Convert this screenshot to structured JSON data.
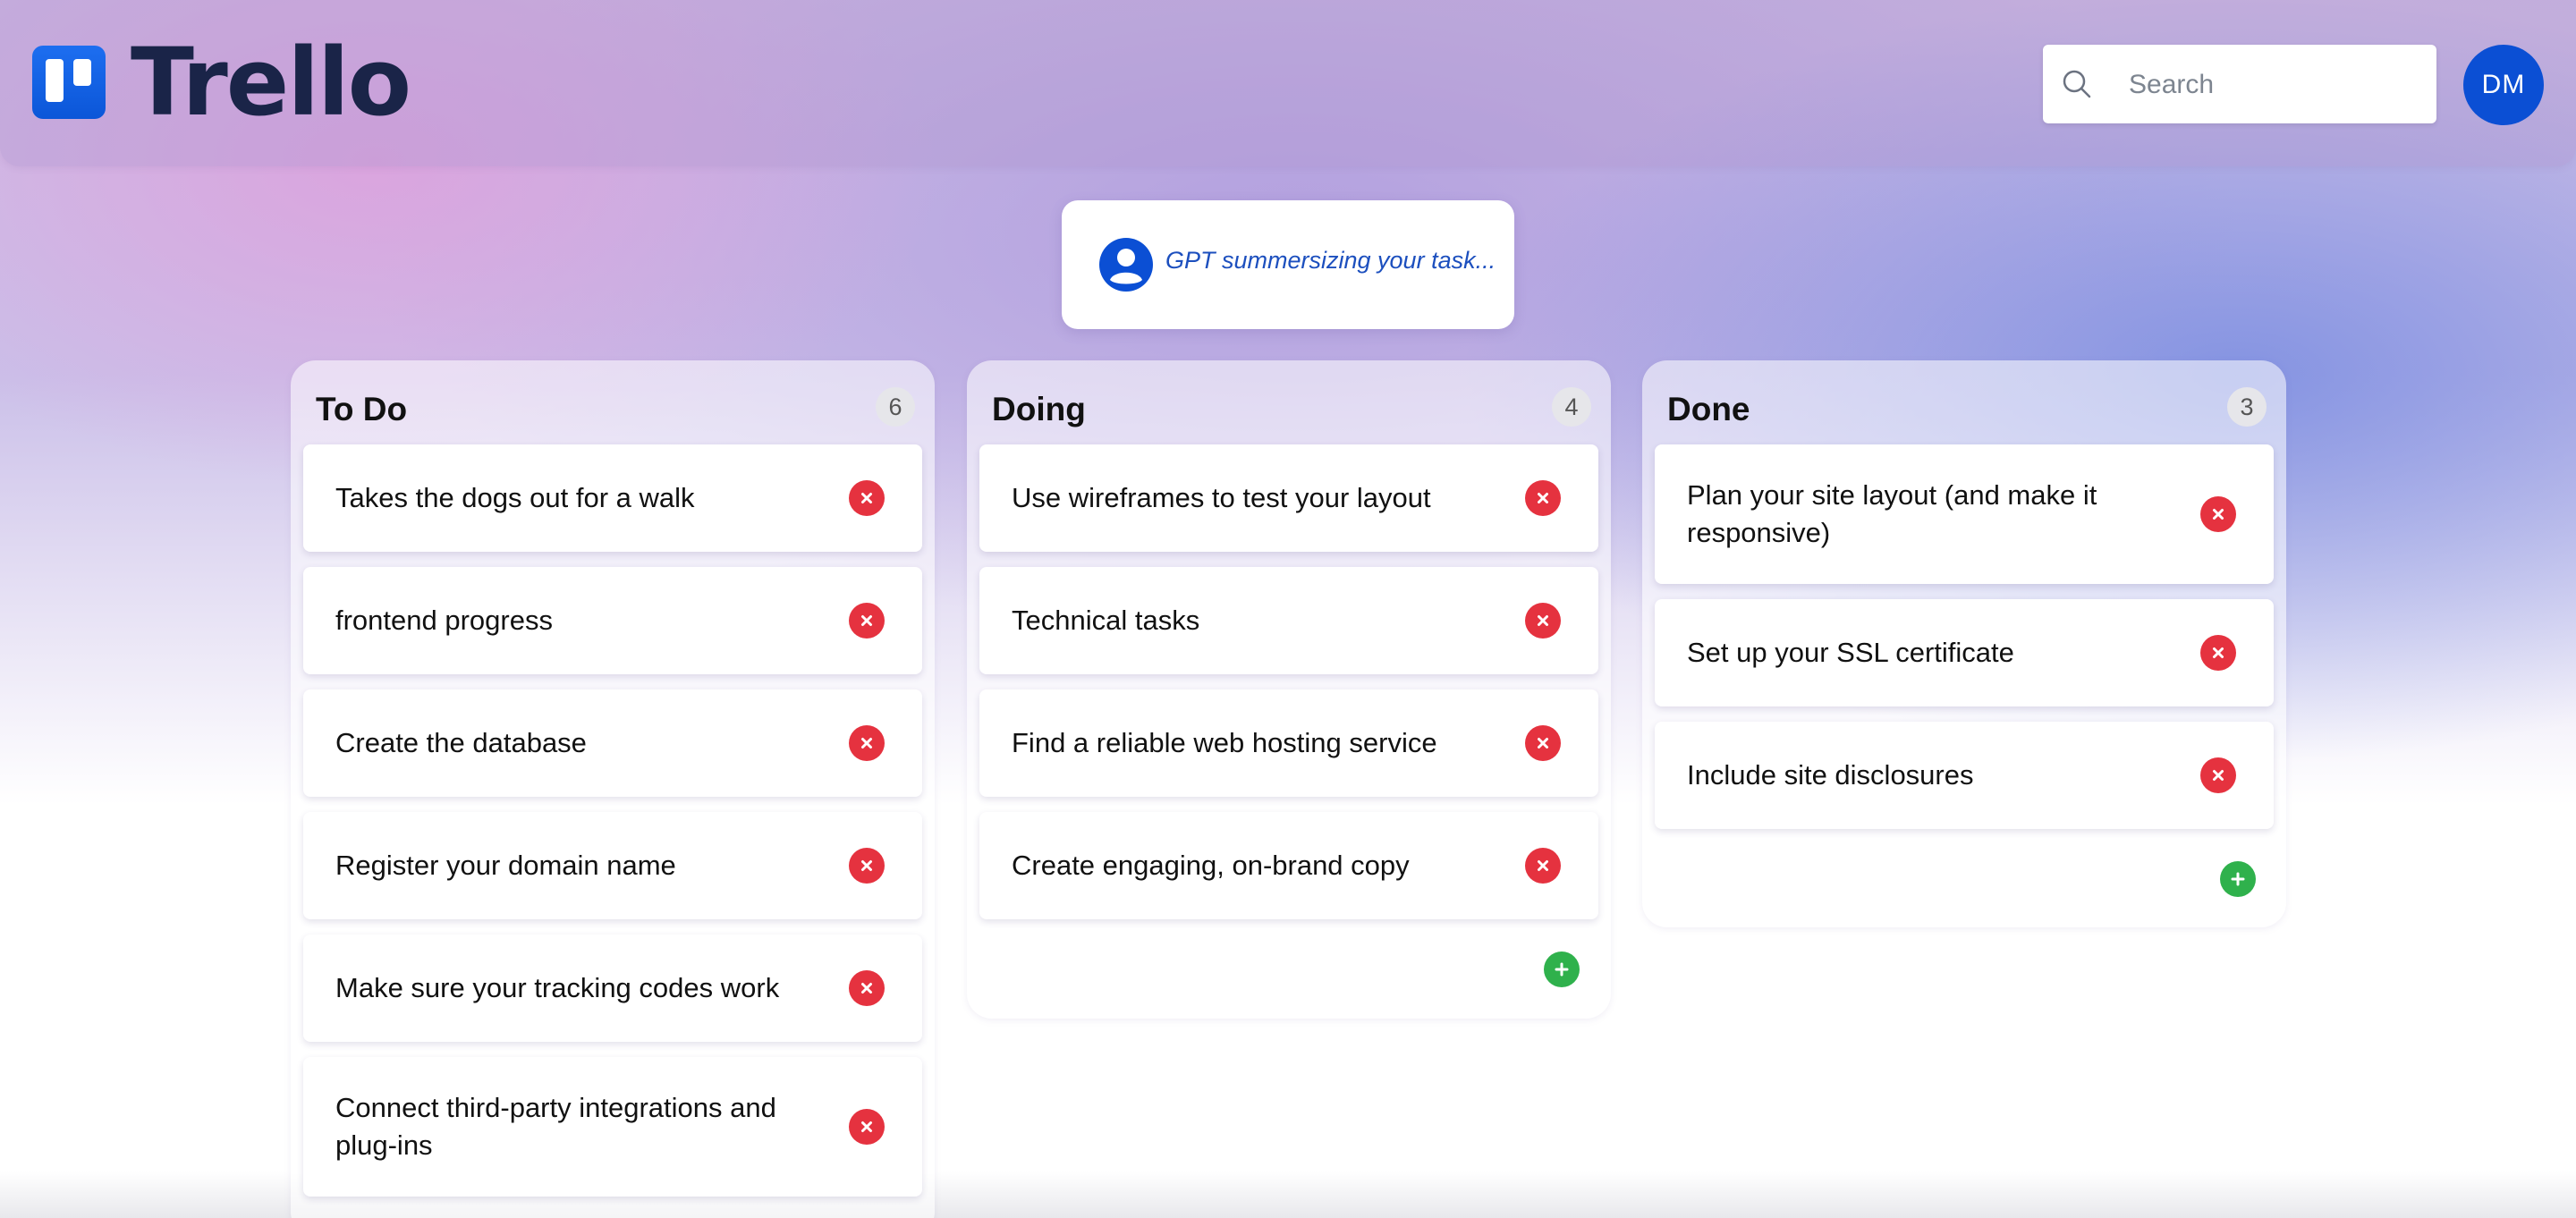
{
  "app": {
    "name": "Trello"
  },
  "header": {
    "search": {
      "placeholder": "Search",
      "value": ""
    },
    "avatar_initials": "DM"
  },
  "gpt_status": {
    "text": "GPT summersizing your task..."
  },
  "colors": {
    "delete": "#e5323f",
    "add": "#2fb14c",
    "brand": "#0b56d8",
    "gpt_text": "#1c4fbe"
  },
  "columns": [
    {
      "title": "To Do",
      "count": "6",
      "cards": [
        "Takes the dogs out for a walk",
        "frontend progress",
        "Create the database",
        "Register your domain name",
        "Make sure your tracking codes work",
        "Connect third-party integrations and plug-ins"
      ]
    },
    {
      "title": "Doing",
      "count": "4",
      "cards": [
        "Use wireframes to test your layout",
        "Technical tasks",
        "Find a reliable web hosting service",
        "Create engaging, on-brand copy"
      ]
    },
    {
      "title": "Done",
      "count": "3",
      "cards": [
        "Plan your site layout (and make it responsive)",
        "Set up your SSL certificate",
        "Include site disclosures"
      ]
    }
  ]
}
